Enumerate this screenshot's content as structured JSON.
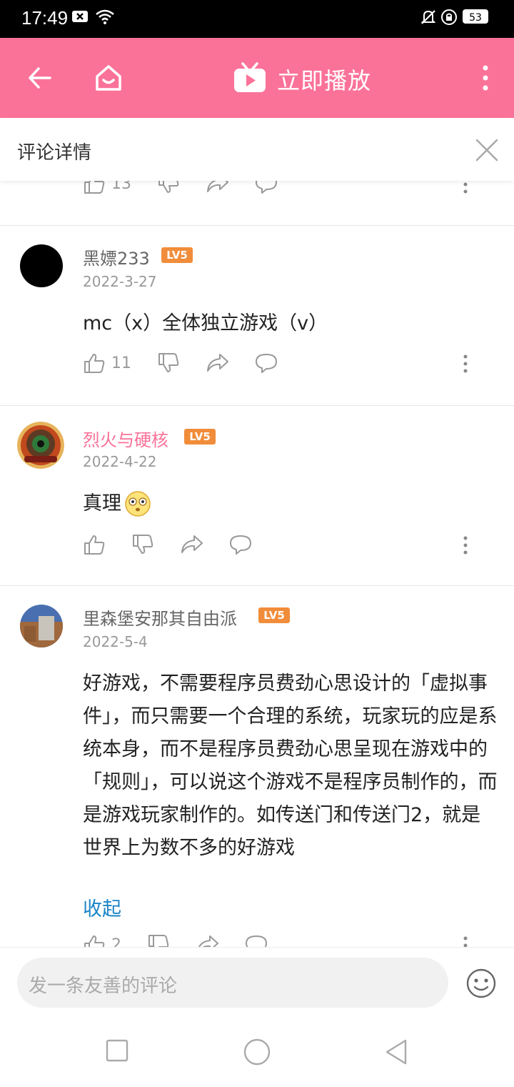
{
  "status": {
    "time": "17:49",
    "battery": "53"
  },
  "appbar": {
    "play_label": "立即播放"
  },
  "panel": {
    "title": "评论详情"
  },
  "top_partial": {
    "like_count": "13"
  },
  "comments": [
    {
      "user": "黑嫖233",
      "level": "LV5",
      "date": "2022-3-27",
      "text": "mc（x）全体独立游戏（v）",
      "likes": "11"
    },
    {
      "user": "烈火与硬核",
      "level": "LV5",
      "date": "2022-4-22",
      "text": "真理",
      "likes": ""
    },
    {
      "user": "里森堡安那其自由派",
      "level": "LV5",
      "date": "2022-5-4",
      "text": "好游戏，不需要程序员费劲心思设计的「虚拟事件」，而只需要一个合理的系统，玩家玩的应是系统本身，而不是程序员费劲心思呈现在游戏中的「规则」，可以说这个游戏不是程序员制作的，而是游戏玩家制作的。如传送门和传送门2，就是世界上为数不多的好游戏",
      "collapse_label": "收起",
      "likes": "2"
    }
  ],
  "compose": {
    "placeholder": "发一条友善的评论"
  },
  "colors": {
    "accent": "#fb7299",
    "level_badge": "#f18d3a",
    "link": "#1b85c7"
  }
}
